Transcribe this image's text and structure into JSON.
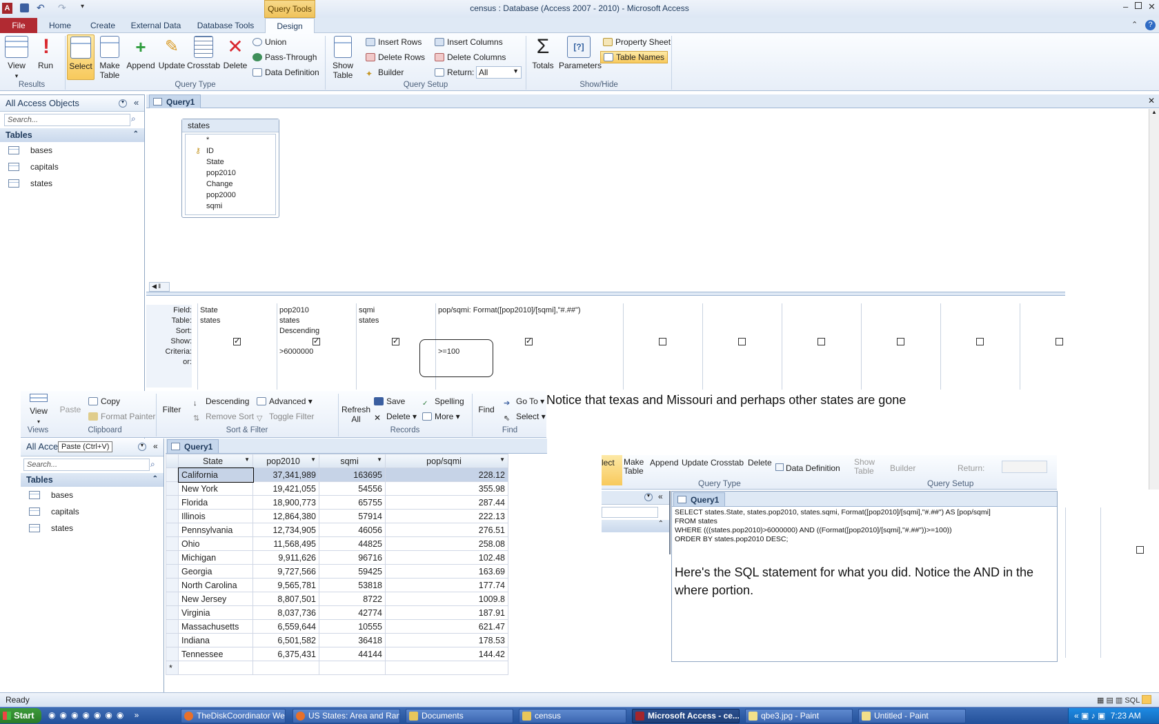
{
  "title": "census : Database (Access 2007 - 2010)  -  Microsoft Access",
  "contextual": "Query Tools",
  "tabs": [
    "File",
    "Home",
    "Create",
    "External Data",
    "Database Tools",
    "Design"
  ],
  "ribbon": {
    "results": {
      "label": "Results",
      "view": "View",
      "run": "Run"
    },
    "qtype": {
      "label": "Query Type",
      "select": "Select",
      "make_table": "Make Table",
      "append": "Append",
      "update": "Update",
      "crosstab": "Crosstab",
      "delete": "Delete",
      "union": "Union",
      "pass": "Pass-Through",
      "ddef": "Data Definition"
    },
    "setup": {
      "label": "Query Setup",
      "show_table": "Show Table",
      "ins_rows": "Insert Rows",
      "del_rows": "Delete Rows",
      "builder": "Builder",
      "ins_cols": "Insert Columns",
      "del_cols": "Delete Columns",
      "return_lbl": "Return:",
      "return_val": "All"
    },
    "showhide": {
      "label": "Show/Hide",
      "totals": "Totals",
      "params": "Parameters",
      "prop": "Property Sheet",
      "tnames": "Table Names"
    }
  },
  "nav": {
    "title": "All Access Objects",
    "search": "Search...",
    "group": "Tables",
    "items": [
      "bases",
      "capitals",
      "states"
    ]
  },
  "query": {
    "tab": "Query1",
    "table": {
      "name": "states",
      "fields": [
        "*",
        "ID",
        "State",
        "pop2010",
        "Change",
        "pop2000",
        "sqmi"
      ]
    },
    "grid": {
      "labels": [
        "Field:",
        "Table:",
        "Sort:",
        "Show:",
        "Criteria:",
        "or:"
      ],
      "cols": [
        {
          "field": "State",
          "table": "states",
          "sort": "",
          "show": true,
          "criteria": ""
        },
        {
          "field": "pop2010",
          "table": "states",
          "sort": "Descending",
          "show": true,
          "criteria": ">6000000"
        },
        {
          "field": "sqmi",
          "table": "states",
          "sort": "",
          "show": true,
          "criteria": ""
        },
        {
          "field": "pop/sqmi: Format([pop2010]/[sqmi],\"#.##\")",
          "table": "",
          "sort": "",
          "show": true,
          "criteria": ">=100"
        }
      ]
    }
  },
  "home_ribbon": {
    "view": "View",
    "views": "Views",
    "paste": "Paste",
    "copy": "Copy",
    "format_painter": "Format Painter",
    "clipboard": "Clipboard",
    "filter": "Filter",
    "descending": "Descending",
    "remove_sort": "Remove Sort",
    "advanced": "Advanced",
    "toggle_filter": "Toggle Filter",
    "sortfilter": "Sort & Filter",
    "refresh": "Refresh All",
    "save": "Save",
    "delete": "Delete",
    "spelling": "Spelling",
    "more": "More",
    "records": "Records",
    "find": "Find",
    "goto": "Go To",
    "select": "Select",
    "findgrp": "Find"
  },
  "nav2": {
    "title": "All Acce",
    "tooltip": "Paste (Ctrl+V)",
    "search": "Search...",
    "group": "Tables",
    "items": [
      "bases",
      "capitals",
      "states"
    ]
  },
  "datasheet": {
    "tab": "Query1",
    "headers": [
      "State",
      "pop2010",
      "sqmi",
      "pop/sqmi"
    ],
    "rows": [
      [
        "California",
        "37,341,989",
        "163695",
        "228.12"
      ],
      [
        "New York",
        "19,421,055",
        "54556",
        "355.98"
      ],
      [
        "Florida",
        "18,900,773",
        "65755",
        "287.44"
      ],
      [
        "Illinois",
        "12,864,380",
        "57914",
        "222.13"
      ],
      [
        "Pennsylvania",
        "12,734,905",
        "46056",
        "276.51"
      ],
      [
        "Ohio",
        "11,568,495",
        "44825",
        "258.08"
      ],
      [
        "Michigan",
        "9,911,626",
        "96716",
        "102.48"
      ],
      [
        "Georgia",
        "9,727,566",
        "59425",
        "163.69"
      ],
      [
        "North Carolina",
        "9,565,781",
        "53818",
        "177.74"
      ],
      [
        "New Jersey",
        "8,807,501",
        "8722",
        "1009.8"
      ],
      [
        "Virginia",
        "8,037,736",
        "42774",
        "187.91"
      ],
      [
        "Massachusetts",
        "6,559,644",
        "10555",
        "621.47"
      ],
      [
        "Indiana",
        "6,501,582",
        "36418",
        "178.53"
      ],
      [
        "Tennessee",
        "6,375,431",
        "44144",
        "144.42"
      ]
    ],
    "newrow": "*"
  },
  "note1": "Notice that texas and Missouri and perhaps other states are gone",
  "ribbon3": {
    "select": "lect",
    "make_table": "Make Table",
    "append": "Append",
    "update": "Update",
    "crosstab": "Crosstab",
    "delete": "Delete",
    "ddef": "Data Definition",
    "show_table": "Show Table",
    "builder": "Builder",
    "return_lbl": "Return:",
    "qtype": "Query Type",
    "setup": "Query Setup"
  },
  "sql": {
    "tab": "Query1",
    "lines": [
      "SELECT states.State, states.pop2010, states.sqmi, Format([pop2010]/[sqmi],\"#.##\") AS [pop/sqmi]",
      "FROM states",
      "WHERE (((states.pop2010)>6000000) AND ((Format([pop2010]/[sqmi],\"#.##\"))>=100))",
      "ORDER BY states.pop2010 DESC;"
    ]
  },
  "note2": "Here's the SQL statement for what you did. Notice the AND in the where portion.",
  "status": "Ready",
  "taskbar": {
    "start": "Start",
    "items": [
      "TheDiskCoordinator Web...",
      "US States: Area and Ran...",
      "Documents",
      "census",
      "Microsoft Access - ce...",
      "qbe3.jpg - Paint",
      "Untitled - Paint"
    ],
    "clock": "7:23 AM"
  }
}
